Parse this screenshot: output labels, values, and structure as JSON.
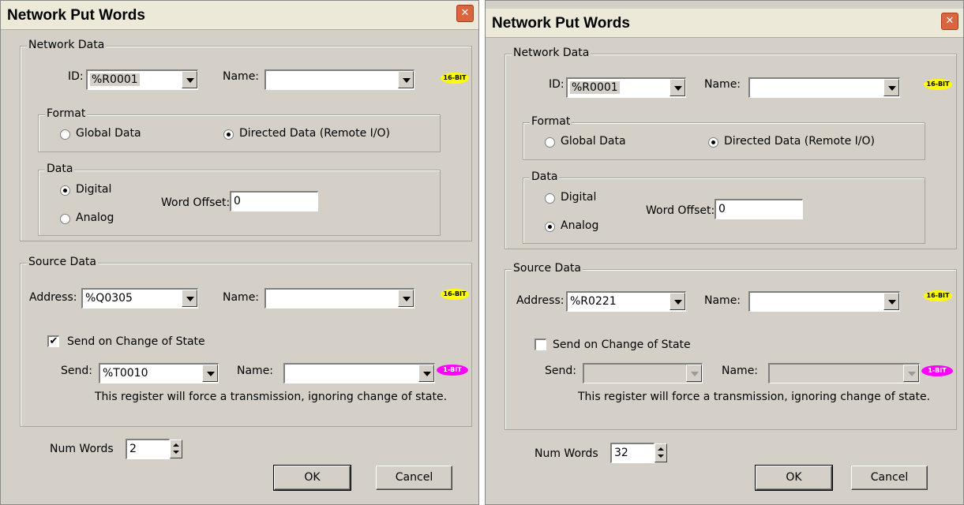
{
  "dialogs": [
    {
      "title": "Network Put Words",
      "close_label": "✕",
      "network_data": {
        "label": "Network Data",
        "id_label": "ID:",
        "id_value": "%R0001",
        "name_label": "Name:",
        "name_value": "",
        "badge": "16-BIT",
        "format": {
          "label": "Format",
          "global_label": "Global Data",
          "directed_label": "Directed Data (Remote I/O)",
          "selected": "directed"
        },
        "data": {
          "label": "Data",
          "digital_label": "Digital",
          "analog_label": "Analog",
          "selected": "digital",
          "word_offset_label": "Word Offset:",
          "word_offset_value": "0"
        }
      },
      "source_data": {
        "label": "Source Data",
        "address_label": "Address:",
        "address_value": "%Q0305",
        "name_label": "Name:",
        "name_value": "",
        "badge": "16-BIT",
        "send_on_change_label": "Send on Change of State",
        "send_on_change_checked": "✔",
        "send_label": "Send:",
        "send_value": "%T0010",
        "send_name_label": "Name:",
        "send_name_value": "",
        "send_badge": "1-BIT",
        "note": "This register will force a transmission, ignoring change of state."
      },
      "num_words_label": "Num Words",
      "num_words_value": "2",
      "ok_label": "OK",
      "cancel_label": "Cancel"
    },
    {
      "title": "Network Put Words",
      "close_label": "✕",
      "network_data": {
        "label": "Network Data",
        "id_label": "ID:",
        "id_value": "%R0001",
        "name_label": "Name:",
        "name_value": "",
        "badge": "16-BIT",
        "format": {
          "label": "Format",
          "global_label": "Global Data",
          "directed_label": "Directed Data (Remote I/O)",
          "selected": "directed"
        },
        "data": {
          "label": "Data",
          "digital_label": "Digital",
          "analog_label": "Analog",
          "selected": "analog",
          "word_offset_label": "Word Offset:",
          "word_offset_value": "0"
        }
      },
      "source_data": {
        "label": "Source Data",
        "address_label": "Address:",
        "address_value": "%R0221",
        "name_label": "Name:",
        "name_value": "",
        "badge": "16-BIT",
        "send_on_change_label": "Send on Change of State",
        "send_on_change_checked": "",
        "send_label": "Send:",
        "send_value": "",
        "send_name_label": "Name:",
        "send_name_value": "",
        "send_badge": "1-BIT",
        "note": "This register will force a transmission, ignoring change of state."
      },
      "num_words_label": "Num Words",
      "num_words_value": "32",
      "ok_label": "OK",
      "cancel_label": "Cancel"
    }
  ],
  "colors": {
    "badge_16bit": "#ffff00",
    "badge_1bit": "#ff00ff",
    "dialog_bg": "#d4d0c8",
    "titlebar_bg": "#ece9d8",
    "close_button": "#d9663f"
  }
}
